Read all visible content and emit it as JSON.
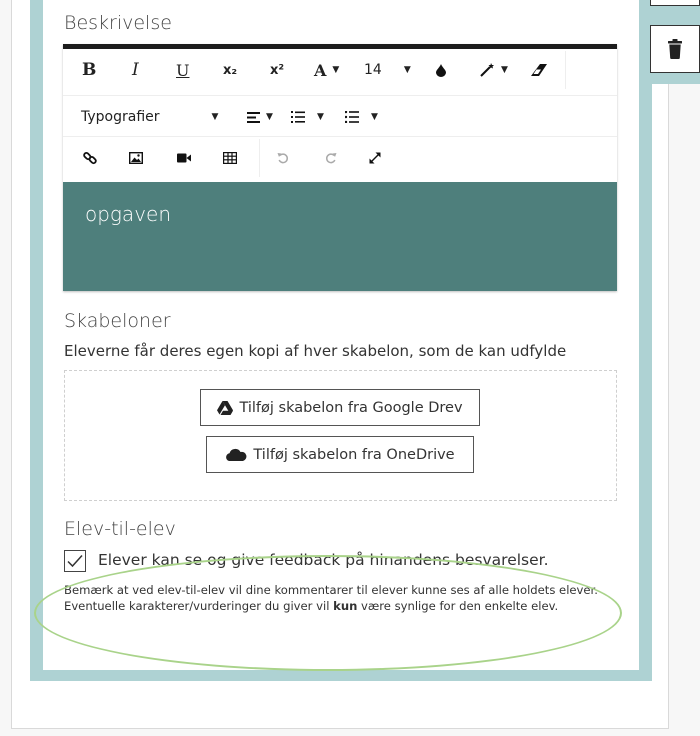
{
  "description": {
    "heading": "Beskrivelse",
    "editor_text": "opgaven",
    "toolbar": {
      "bold": "B",
      "italic": "I",
      "underline": "U",
      "subscript": "x₂",
      "superscript": "x²",
      "font_color": "A",
      "font_size": "14",
      "typography_label": "Typografier"
    }
  },
  "templates": {
    "heading": "Skabeloner",
    "subtitle": "Eleverne får deres egen kopi af hver skabelon, som de kan udfylde",
    "google_button": "Tilføj skabelon fra Google Drev",
    "onedrive_button": "Tilføj skabelon fra OneDrive"
  },
  "peer": {
    "heading": "Elev-til-elev",
    "checkbox_label": "Elever kan se og give feedback på hinandens besvarelser.",
    "checked": true,
    "note_part1": "Bemærk at ved elev-til-elev vil dine kommentarer til elever kunne ses af alle holdets elever. Eventuelle karakterer/vurderinger du giver vil ",
    "note_bold": "kun",
    "note_part2": " være synlige for den enkelte elev."
  },
  "colors": {
    "frame": "#aed2d3",
    "editor_body": "#4e7f7c",
    "highlight": "#a9d38a"
  },
  "icons": {
    "side": "trash-icon",
    "google": "google-drive-icon",
    "onedrive": "onedrive-cloud-icon"
  }
}
